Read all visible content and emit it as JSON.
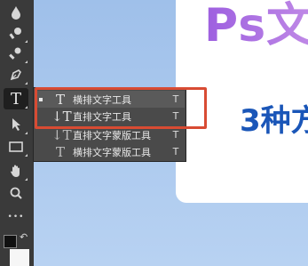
{
  "canvas": {
    "title_text": "Ps文",
    "subtitle_text": "3种方"
  },
  "toolbar": {
    "tools": [
      {
        "name": "blur-tool",
        "icon": "drop-icon"
      },
      {
        "name": "dodge-tool",
        "icon": "dodge-icon"
      },
      {
        "name": "pen-tool",
        "icon": "pen-icon"
      },
      {
        "name": "type-tool",
        "icon": "type-T-icon",
        "label": "T",
        "active": true
      },
      {
        "name": "path-selection-tool",
        "icon": "arrow-icon"
      },
      {
        "name": "rectangle-tool",
        "icon": "rectangle-icon"
      },
      {
        "name": "hand-tool",
        "icon": "hand-icon"
      },
      {
        "name": "zoom-tool",
        "icon": "magnifier-icon"
      },
      {
        "name": "more-tools",
        "icon": "ellipsis-icon",
        "label": "•••"
      }
    ]
  },
  "flyout": {
    "items": [
      {
        "icon_label": "T",
        "label": "横排文字工具",
        "shortcut": "T",
        "selected": true
      },
      {
        "icon_label": "↓T",
        "label": "直排文字工具",
        "shortcut": "T",
        "selected": false
      },
      {
        "icon_label": "↓T",
        "label": "直排文字蒙版工具",
        "shortcut": "T",
        "selected": false
      },
      {
        "icon_label": "T",
        "label": "横排文字蒙版工具",
        "shortcut": "T",
        "selected": false
      }
    ]
  },
  "annotation": {
    "color": "#d84b33"
  },
  "colors": {
    "accent": "#a86de6",
    "subtitle": "#1a56b8",
    "highlight": "#d84b33"
  }
}
